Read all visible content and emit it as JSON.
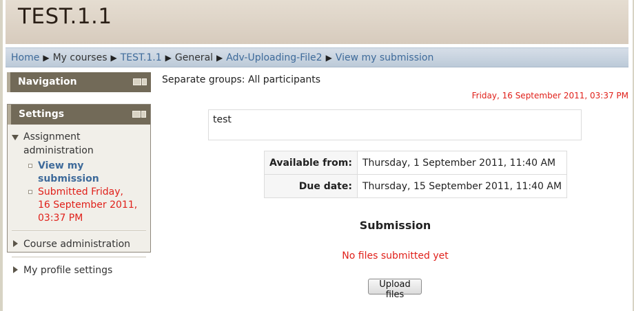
{
  "site": {
    "title": "TEST.1.1"
  },
  "breadcrumb": [
    {
      "label": "Home",
      "link": true
    },
    {
      "label": "My courses",
      "link": false
    },
    {
      "label": "TEST.1.1",
      "link": true
    },
    {
      "label": "General",
      "link": false
    },
    {
      "label": "Adv-Uploading-File2",
      "link": true
    },
    {
      "label": "View my submission",
      "link": true
    }
  ],
  "navigation_block": {
    "title": "Navigation"
  },
  "settings_block": {
    "title": "Settings",
    "assignment_admin": "Assignment administration",
    "view_submission": "View my submission",
    "submitted_line1": "Submitted Friday,",
    "submitted_line2": "16 September 2011,",
    "submitted_line3": "03:37 PM",
    "course_admin": "Course administration",
    "profile_settings": "My profile settings"
  },
  "main": {
    "groups": "Separate groups: All participants",
    "current_date": "Friday, 16 September 2011, 03:37 PM",
    "intro_text": "test",
    "available_label": "Available from:",
    "available_value": "Thursday, 1 September 2011, 11:40 AM",
    "due_label": "Due date:",
    "due_value": "Thursday, 15 September 2011, 11:40 AM",
    "submission_heading": "Submission",
    "no_files": "No files submitted yet",
    "upload_button": "Upload files"
  },
  "colors": {
    "link": "#3e6a9a",
    "alert": "#e0201a",
    "block_header": "#726a58",
    "breadcrumb_bg": "#c8d3df",
    "header_bg": "#ded5c8"
  }
}
